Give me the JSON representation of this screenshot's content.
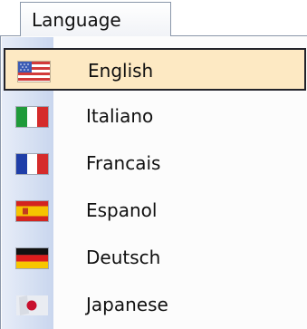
{
  "menu": {
    "title": "Language",
    "items": [
      {
        "label": "English",
        "icon": "us-flag-icon"
      },
      {
        "label": "Italiano",
        "icon": "italy-flag-icon"
      },
      {
        "label": "Francais",
        "icon": "france-flag-icon"
      },
      {
        "label": "Espanol",
        "icon": "spain-flag-icon"
      },
      {
        "label": "Deutsch",
        "icon": "germany-flag-icon"
      },
      {
        "label": "Japanese",
        "icon": "japan-flag-icon"
      }
    ],
    "selected_index": 0
  },
  "colors": {
    "selection_fill": "#fde9c3",
    "selection_border": "#23242b",
    "gutter_light": "#e7edf8",
    "gutter_dark": "#c9d6ee"
  }
}
